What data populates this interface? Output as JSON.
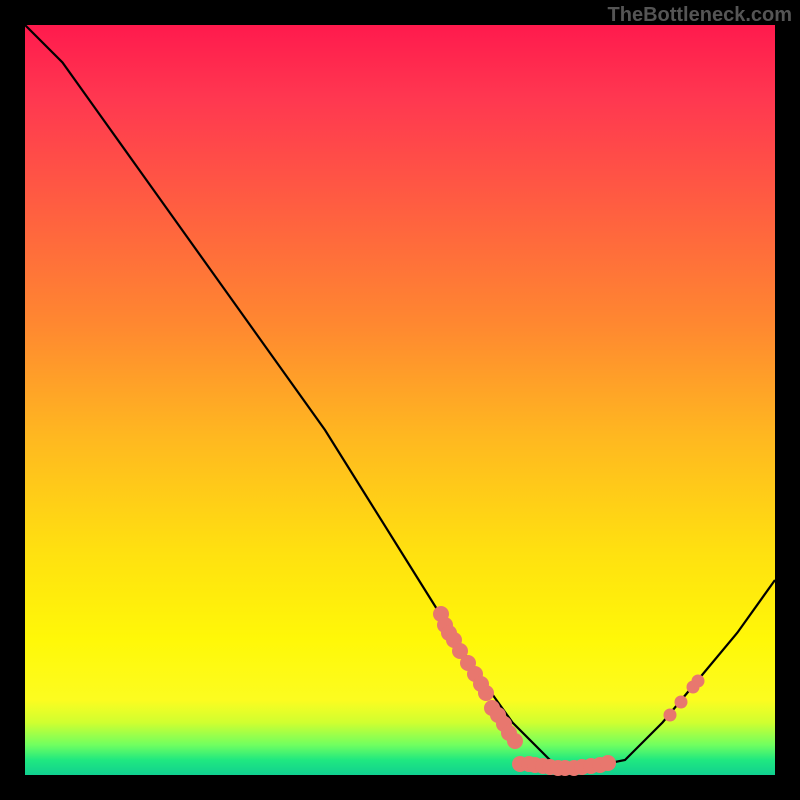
{
  "watermark": "TheBottleneck.com",
  "chart_data": {
    "type": "line",
    "title": "",
    "xlabel": "",
    "ylabel": "",
    "xlim": [
      0,
      100
    ],
    "ylim": [
      0,
      100
    ],
    "curve": {
      "x": [
        0,
        5,
        10,
        15,
        20,
        25,
        30,
        35,
        40,
        45,
        50,
        55,
        60,
        65,
        70,
        72,
        75,
        80,
        85,
        90,
        95,
        100
      ],
      "y": [
        100,
        95,
        88,
        81,
        74,
        67,
        60,
        53,
        46,
        38,
        30,
        22,
        14,
        7,
        2,
        1,
        1,
        2,
        7,
        13,
        19,
        26
      ]
    },
    "markers": [
      {
        "x": 55.5,
        "y": 21.5,
        "size": "big"
      },
      {
        "x": 56.0,
        "y": 20.0,
        "size": "big"
      },
      {
        "x": 56.5,
        "y": 19.0,
        "size": "big"
      },
      {
        "x": 57.2,
        "y": 18.0,
        "size": "big"
      },
      {
        "x": 58.0,
        "y": 16.5,
        "size": "big"
      },
      {
        "x": 59.0,
        "y": 15.0,
        "size": "big"
      },
      {
        "x": 60.0,
        "y": 13.5,
        "size": "big"
      },
      {
        "x": 60.8,
        "y": 12.2,
        "size": "big"
      },
      {
        "x": 61.5,
        "y": 11.0,
        "size": "big"
      },
      {
        "x": 62.3,
        "y": 9.0,
        "size": "big"
      },
      {
        "x": 63.0,
        "y": 8.0,
        "size": "big"
      },
      {
        "x": 63.8,
        "y": 6.8,
        "size": "big"
      },
      {
        "x": 64.5,
        "y": 5.6,
        "size": "big"
      },
      {
        "x": 65.3,
        "y": 4.6,
        "size": "big"
      },
      {
        "x": 66.0,
        "y": 1.5,
        "size": "big"
      },
      {
        "x": 67.2,
        "y": 1.5,
        "size": "big"
      },
      {
        "x": 68.0,
        "y": 1.3,
        "size": "big"
      },
      {
        "x": 69.0,
        "y": 1.2,
        "size": "big"
      },
      {
        "x": 70.0,
        "y": 1.1,
        "size": "big"
      },
      {
        "x": 71.0,
        "y": 1.0,
        "size": "big"
      },
      {
        "x": 72.0,
        "y": 1.0,
        "size": "big"
      },
      {
        "x": 73.2,
        "y": 1.0,
        "size": "big"
      },
      {
        "x": 74.2,
        "y": 1.1,
        "size": "big"
      },
      {
        "x": 75.5,
        "y": 1.2,
        "size": "big"
      },
      {
        "x": 76.7,
        "y": 1.4,
        "size": "big"
      },
      {
        "x": 77.7,
        "y": 1.6,
        "size": "big"
      },
      {
        "x": 86.0,
        "y": 8.0,
        "size": "normal"
      },
      {
        "x": 87.5,
        "y": 9.8,
        "size": "normal"
      },
      {
        "x": 89.0,
        "y": 11.8,
        "size": "normal"
      },
      {
        "x": 89.7,
        "y": 12.6,
        "size": "normal"
      }
    ]
  }
}
